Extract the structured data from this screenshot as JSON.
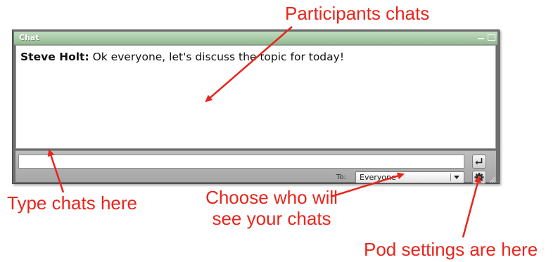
{
  "pod": {
    "title": "Chat",
    "messages": [
      {
        "sender": "Steve Holt:",
        "text": " Ok everyone, let's discuss the topic for today!"
      }
    ],
    "input": {
      "value": "",
      "placeholder": ""
    },
    "to_label": "To:",
    "to_select": {
      "selected": "Everyone"
    },
    "icons": {
      "minimize": "minimize-icon",
      "maximize": "maximize-icon",
      "send": "enter-return-icon",
      "dropdown": "chevron-down-icon",
      "settings": "gear-icon",
      "resize": "resize-grip-icon"
    }
  },
  "annotations": {
    "participants": "Participants chats",
    "type": "Type chats here",
    "choose_line1": "Choose who will",
    "choose_line2": "see your chats",
    "pod_settings": "Pod settings are here",
    "color": "#e8251c"
  }
}
